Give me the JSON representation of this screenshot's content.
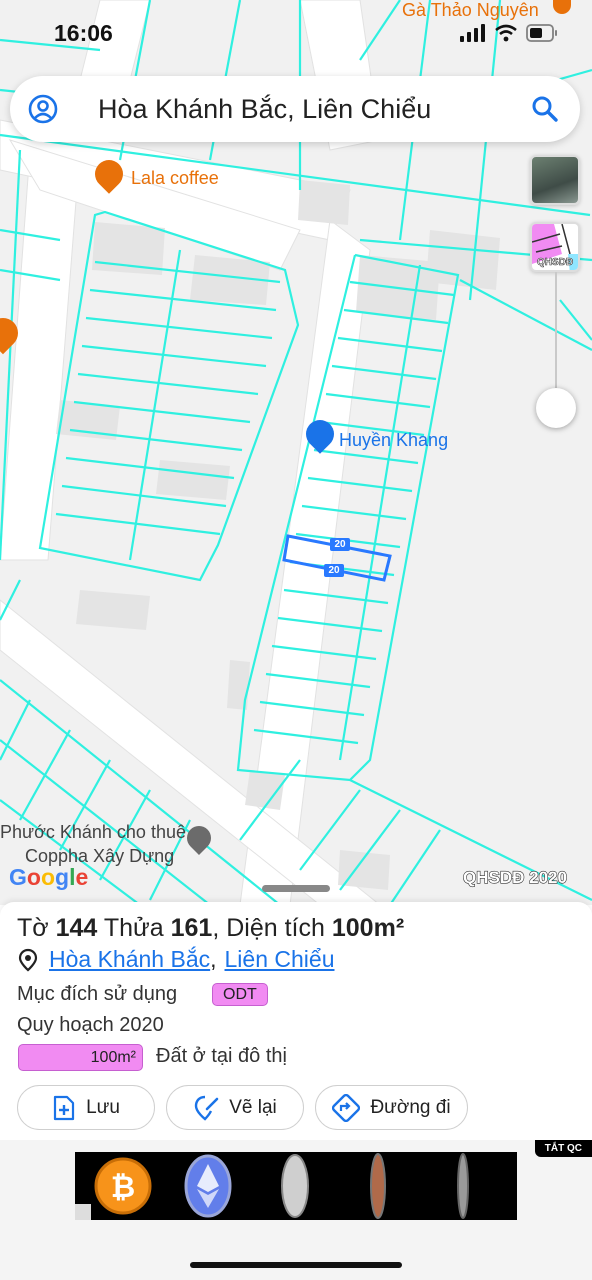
{
  "status": {
    "time": "16:06"
  },
  "search": {
    "query": "Hòa Khánh Bắc, Liên Chiểu"
  },
  "map": {
    "poi": {
      "top_right": "Gà Thảo Nguyên",
      "cafe": "Lala coffee",
      "shop": "Huyền Khang",
      "rental_line1": "Phước Khánh cho thuê",
      "rental_line2": "Coppha Xây Dựng"
    },
    "dimension_top": "20",
    "dimension_bottom": "20",
    "layer_label": "QHSDĐ",
    "watermark": "QHSDĐ 2020",
    "google": [
      "G",
      "o",
      "o",
      "g",
      "l",
      "e"
    ]
  },
  "parcel": {
    "sheet_label": "Tờ",
    "sheet_no": "144",
    "plot_label": "Thửa",
    "plot_no": "161",
    "area_label": "Diện tích",
    "area": "100m²",
    "ward": "Hòa Khánh Bắc",
    "separator": ",",
    "district": "Liên Chiểu",
    "purpose_label": "Mục đích sử dụng",
    "purpose_code": "ODT",
    "plan_label": "Quy hoạch 2020",
    "plan_area": "100m²",
    "plan_desc": "Đất ở tại đô thị"
  },
  "actions": {
    "save": "Lưu",
    "redraw": "Vẽ lại",
    "route": "Đường đi"
  },
  "ad": {
    "close_label": "TẮT QC"
  },
  "colors": {
    "parcel_line": "#2ff0e0",
    "accent": "#1a73e8",
    "zoning": "#f18bf2"
  }
}
